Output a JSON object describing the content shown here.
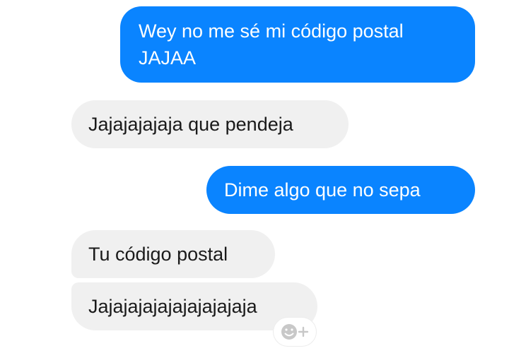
{
  "conversation": {
    "messages": [
      {
        "sender": "me",
        "text": "Wey no me sé mi código postal\nJAJAA"
      },
      {
        "sender": "them",
        "text": "Jajajajajaja que pendeja"
      },
      {
        "sender": "me",
        "text": "Dime algo que no sepa"
      },
      {
        "sender": "them",
        "text": "Tu código postal"
      },
      {
        "sender": "them",
        "text": "Jajajajajajajajajajaja"
      }
    ]
  },
  "reaction_button": {
    "icon": "smiley-plus-icon"
  },
  "colors": {
    "sent_bubble": "#0a84ff",
    "received_bubble": "#f0f0f0",
    "sent_text": "#ffffff",
    "received_text": "#1a1a1a",
    "background": "#ffffff"
  }
}
